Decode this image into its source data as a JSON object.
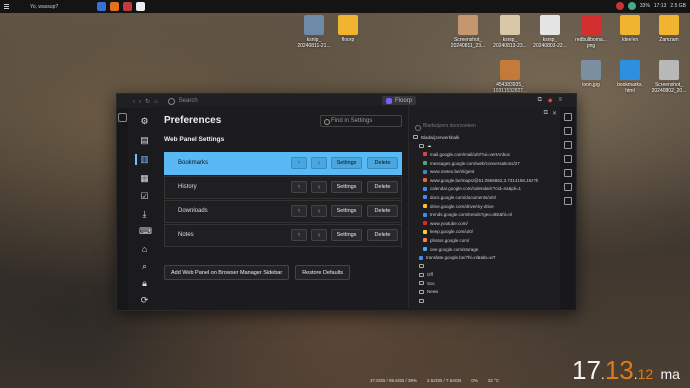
{
  "topbar": {
    "title": "Yo, wassup?",
    "tray_text": "17:13",
    "status_a": "33%",
    "status_b": "2.5 GB"
  },
  "desktop_icons": [
    {
      "label": "ksnip_ 20240811-21..."
    },
    {
      "label": "floorp"
    },
    {
      "label": "Screenshot_ 20240811_23..."
    },
    {
      "label": "ksnip_ 20240813-23..."
    },
    {
      "label": "ksnip_ 20240803-22..."
    },
    {
      "label": "redbullboma... png"
    },
    {
      "label": "Idee'en"
    },
    {
      "label": "Zamzam"
    },
    {
      "label": "454383935_ 1031153282T..."
    },
    {
      "label": "loon.jpg"
    },
    {
      "label": "bookmarks. html"
    },
    {
      "label": "Screenshot_ 20240802_20..."
    }
  ],
  "browser": {
    "search_placeholder": "Search",
    "floorp_label": "Floorp"
  },
  "preferences": {
    "title": "Preferences",
    "find_placeholder": "Find in Settings",
    "section_title": "Web Panel Settings",
    "panels": [
      {
        "name": "Bookmarks",
        "up": "↑",
        "down": "↓",
        "settings": "Settings",
        "delete": "Delete",
        "selected": true
      },
      {
        "name": "History",
        "up": "↑",
        "down": "↓",
        "settings": "Settings",
        "delete": "Delete",
        "selected": false
      },
      {
        "name": "Downloads",
        "up": "↑",
        "down": "↓",
        "settings": "Settings",
        "delete": "Delete",
        "selected": false
      },
      {
        "name": "Notes",
        "up": "↑",
        "down": "↓",
        "settings": "Settings",
        "delete": "Delete",
        "selected": false
      }
    ],
    "add_button": "Add Web Panel on Browser Manager Sidebar",
    "restore_button": "Restore Defaults"
  },
  "bookmarks_panel": {
    "search_placeholder": "Bladwijzers doorzoeken",
    "items": [
      {
        "text": "Bladwijzerwerkbalk",
        "kind": "folder"
      },
      {
        "text": "☁",
        "kind": "folder"
      },
      {
        "text": "mail.google.com/mail/u/0/?ui=vertAnbox",
        "kind": "link",
        "color": "#d44"
      },
      {
        "text": "messages.google.com/web/conversations/27",
        "kind": "link",
        "color": "#4a8"
      },
      {
        "text": "www.meteo.be/nl/gent",
        "kind": "link",
        "color": "#48c"
      },
      {
        "text": "www.google.be/maps/@51.0566862,3.7314156,15z?h",
        "kind": "link",
        "color": "#e63"
      },
      {
        "text": "calendar.google.com/calendar/r?cid=ns&pli=1",
        "kind": "link",
        "color": "#48f"
      },
      {
        "text": "docs.google.com/documents/u/0/",
        "kind": "link",
        "color": "#48f"
      },
      {
        "text": "drive.google.com/drive/my-drive",
        "kind": "link",
        "color": "#fb3"
      },
      {
        "text": "trends.google.com/trends?geo=BE&hl=nl",
        "kind": "link",
        "color": "#48f"
      },
      {
        "text": "www.youtube.com/",
        "kind": "link",
        "color": "#e22"
      },
      {
        "text": "keep.google.com/u/0/",
        "kind": "link",
        "color": "#fc3"
      },
      {
        "text": "photos.google.com/",
        "kind": "link",
        "color": "#e84"
      },
      {
        "text": "one.google.com/storage",
        "kind": "link",
        "color": "#4af"
      },
      {
        "text": "translate.google.be/?hl=nl&tab=wT",
        "kind": "link",
        "color": "#48f"
      },
      {
        "text": "",
        "kind": "folder"
      },
      {
        "text": "Off",
        "kind": "folder"
      },
      {
        "text": "Soc",
        "kind": "folder"
      },
      {
        "text": "News",
        "kind": "folder"
      },
      {
        "text": "",
        "kind": "folder"
      }
    ]
  },
  "taskbar_stats": {
    "disk": "37.6GB / 95.6GB / 39%",
    "memory": "2.52GB / 7.54GB",
    "cpu": "0%",
    "temp": "32 °C"
  },
  "clock": {
    "hour": "17",
    "min": "13",
    "sec": "12",
    "day": "ma"
  }
}
